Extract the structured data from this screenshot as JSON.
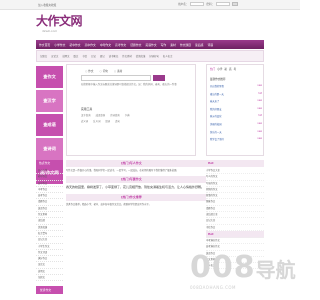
{
  "topbar": {
    "favorite": "加入收藏夹收藏",
    "login_user": "用户名：",
    "login_pass": "密码："
  },
  "logo": {
    "title": "大作文网",
    "subtitle": "dzw0.com"
  },
  "nav": [
    "作文首页",
    "小学作文",
    "初中作文",
    "高中作文",
    "中考作文",
    "高考作文",
    "话题作文",
    "英语作文",
    "写作",
    "素材",
    "作文题目",
    "读后感",
    "评语"
  ],
  "subnav": [
    "记叙文",
    "议论文",
    "说明文",
    "散文",
    "书信",
    "日记",
    "周记",
    "读书笔记",
    "作文素材",
    "优美段落",
    "好词好句",
    "名人名言"
  ],
  "leftcol": [
    "查作文",
    "查汉字",
    "查成语",
    "查诗词",
    "阅/作文网"
  ],
  "center": {
    "radios": [
      "作文",
      "词句",
      "素材"
    ],
    "hint": "在搜索框中输入作文标题或关键词即可查找相关作文，如：我的妈妈、春天、难忘的一件事",
    "tools_title": "实用工具",
    "tools": [
      [
        "汉字查询",
        "成语查询",
        "诗词查询",
        "字典"
      ],
      [
        "近义词",
        "反义词",
        "组词",
        "造句"
      ]
    ]
  },
  "right": {
    "tabs": [
      "热门",
      "小学",
      "初",
      "高",
      "考"
    ],
    "title": "最新作文推荐",
    "items": [
      [
        "开启我的梦想",
        "new"
      ],
      [
        "难忘的那一天",
        "hot"
      ],
      [
        "春天来了",
        "new"
      ],
      [
        "我的好朋友",
        "new"
      ],
      [
        "家乡的变化",
        "hot"
      ],
      [
        "美丽的校园",
        "new"
      ],
      [
        "快乐的一天",
        "new"
      ],
      [
        "我学会了坚持",
        "new"
      ]
    ]
  },
  "hot": {
    "left": "热点作文",
    "right": "Hot"
  },
  "hotlist": [
    "开心小学",
    "初中作文",
    "高中作文",
    "中考作文",
    "高考作文",
    "话题作文",
    "英语作文",
    "作文素材",
    "读后感",
    "优美段落",
    "名言警句",
    "日记大全",
    "小学生作文",
    "作文评语",
    "满分作文",
    "议论文",
    "说明文",
    "记叙文"
  ],
  "sections": [
    {
      "title": "[热门]写人作文",
      "body": "写作文是一件很开心的事，我和同学们一起读书、一起学习，一起成长，在老师的教导下我们懂得了很多道理。",
      "big": false
    },
    {
      "title": "[热门]写景作文",
      "body": "春天的校园里，柳树发芽了，小草变绿了，花儿竞相开放，到处充满着生机与活力，让人心情格外舒畅。",
      "big": true
    },
    {
      "title": "[热门]作文推荐",
      "body": "优秀作文推荐，精选小学、初中、高中各年级作文范文，帮助同学们提高写作水平。",
      "big": false
    }
  ],
  "rcol": [
    "小学作文大全",
    "写人的作文",
    "写景的作文",
    "状物的作文",
    "叙事的作文",
    "想象作文",
    "话题作文",
    "读后感大全",
    "日记大全",
    "书信作文"
  ],
  "rcol_hot": "Hot",
  "rcol2": [
    "中考满分作文",
    "高考满分作文",
    "英语作文",
    "作文素材",
    "名人名言"
  ],
  "footer": "优秀作文",
  "watermark": {
    "big": "008",
    "cn": "导航",
    "small": "008DAOHANG.COM"
  }
}
